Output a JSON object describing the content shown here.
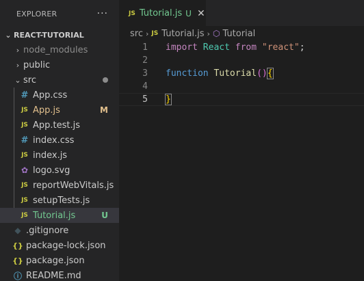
{
  "explorer": {
    "title": "EXPLORER",
    "more": "···",
    "section": "REACT-TUTORIAL",
    "folders": {
      "node_modules": "node_modules",
      "public": "public",
      "src": "src"
    },
    "src_files": [
      {
        "label": "App.css",
        "icon": "#",
        "badge": ""
      },
      {
        "label": "App.js",
        "icon": "JS",
        "badge": "M"
      },
      {
        "label": "App.test.js",
        "icon": "JS",
        "badge": ""
      },
      {
        "label": "index.css",
        "icon": "#",
        "badge": ""
      },
      {
        "label": "index.js",
        "icon": "JS",
        "badge": ""
      },
      {
        "label": "logo.svg",
        "icon": "svg",
        "badge": ""
      },
      {
        "label": "reportWebVitals.js",
        "icon": "JS",
        "badge": ""
      },
      {
        "label": "setupTests.js",
        "icon": "JS",
        "badge": ""
      },
      {
        "label": "Tutorial.js",
        "icon": "JS",
        "badge": "U"
      }
    ],
    "root_files": [
      {
        "label": ".gitignore",
        "icon": "git"
      },
      {
        "label": "package-lock.json",
        "icon": "{}"
      },
      {
        "label": "package.json",
        "icon": "{}"
      },
      {
        "label": "README.md",
        "icon": "info"
      }
    ]
  },
  "tab": {
    "icon": "JS",
    "name": "Tutorial.js",
    "status": "U",
    "close": "✕"
  },
  "breadcrumb": {
    "folder": "src",
    "file_icon": "JS",
    "file": "Tutorial.js",
    "symbol": "Tutorial"
  },
  "code": {
    "line_numbers": [
      "1",
      "2",
      "3",
      "4",
      "5"
    ],
    "l1_import": "import",
    "l1_react": "React",
    "l1_from": "from",
    "l1_str": "\"react\"",
    "l1_semi": ";",
    "l3_function": "function",
    "l3_name": "Tutorial",
    "l3_parens": "()",
    "l3_brace": "{",
    "l5_brace": "}"
  },
  "colors": {
    "untracked": "#73c991",
    "modified": "#e2c08d",
    "js_icon": "#cbcb41",
    "css_icon": "#519aba"
  }
}
